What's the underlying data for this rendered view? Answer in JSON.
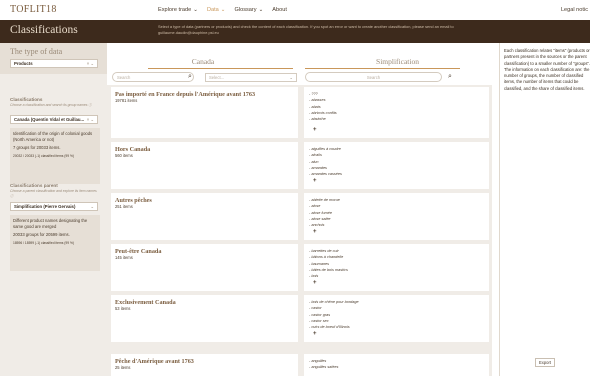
{
  "header": {
    "brand": "TOFLIT18",
    "nav": [
      {
        "label": "Explore trade",
        "active": false
      },
      {
        "label": "Data",
        "active": true
      },
      {
        "label": "Glossary",
        "active": false
      },
      {
        "label": "About",
        "active": false
      }
    ],
    "legal": "Legal notic"
  },
  "band": {
    "title": "Classifications",
    "description": "Select a type of data (partners or products) and check the content of each classification. If you spot an error or want to create another classification, please send an email to guillaume.daudin@dauphine.psl.eu"
  },
  "left": {
    "type_title": "The type of data",
    "type_value": "Products",
    "classif_label": "Classifications",
    "classif_hint": "Choose a classification and search its group names",
    "classif_value": "Canada (Quentin Vidal et Guillau...",
    "classif_info": "Identification of the origin of colonial goods (North America or not)",
    "classif_groups": "7 groups for 20033 items.",
    "classif_small": "20032 / 20033 (-1) classified items (99 %)",
    "parent_label": "Classifications parent",
    "parent_hint": "Choose a parent classification and explore its item names",
    "parent_value": "Simplification (Pierre Gervais)",
    "parent_info": "Different product names designating the same good are merged",
    "parent_groups": "20033 groups for 20599 items.",
    "parent_small": "18596 / 18599 (-1) classified items (99 %)"
  },
  "middle": {
    "col_left": "Canada",
    "col_right": "Simplification",
    "search_placeholder": "Search",
    "select_placeholder": "Select...",
    "search2_placeholder": "Search",
    "rows": [
      {
        "name": "Pas importé en France depuis l'Amérique avant 1763",
        "items": "19781 items",
        "children": [
          "???",
          "abasses",
          "abats",
          "abricots confits",
          "absinthe"
        ]
      },
      {
        "name": "Hors Canada",
        "items": "560 items",
        "children": [
          "aiguilles à coudre",
          "alcalis",
          "alun",
          "amandes",
          "amandes cassées"
        ]
      },
      {
        "name": "Autres pêches",
        "items": "251 items",
        "children": [
          "ablette de morue",
          "alose",
          "alose fumée",
          "alose salée",
          "anchois"
        ]
      },
      {
        "name": "Peut-être Canada",
        "items": "145 items",
        "children": [
          "barrettes de cuir",
          "bâtons à chandelle",
          "baumanes",
          "bâtes de bois mastics",
          "bois"
        ]
      },
      {
        "name": "Exclusivement Canada",
        "items": "53 items",
        "children": [
          "bois de chêne pour bordage",
          "castor",
          "castor gras",
          "castor sec",
          "cuirs de boeuf d'Illinois"
        ]
      },
      {
        "name": "Pêche d'Amérique avant 1763",
        "items": "25 items",
        "children": [
          "anguilles",
          "anguilles salées"
        ]
      }
    ],
    "more_symbol": "+"
  },
  "right": {
    "description": "Each classification relates \"items\" (products or partners present in the sources or the parent classification) to a smaller number of \"groups\". The information on each classification are: the number of groups, the number of classified items, the number of items that could be classified, and the share of classified items.",
    "export_label": "Export"
  }
}
